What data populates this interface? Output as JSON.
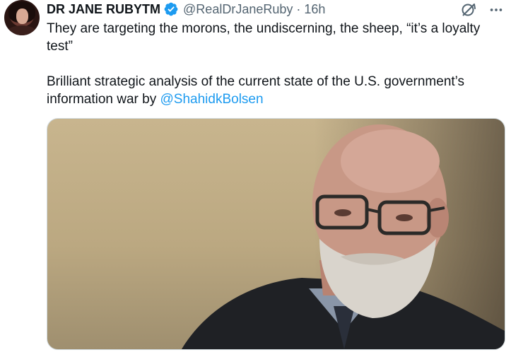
{
  "tweet": {
    "author_name": "DR JANE RUBY",
    "author_suffix": "TM",
    "handle": "@RealDrJaneRuby",
    "separator": "·",
    "timestamp": "16h",
    "text_line1": "They are targeting the morons, the undiscerning, the sheep, “it’s a loyalty test”",
    "text_line2_prefix": "Brilliant strategic analysis of the current state of the U.S. government’s information war by ",
    "mention": "@ShahidkBolsen"
  },
  "icons": {
    "verified": "verified-badge-icon",
    "grok": "grok-icon",
    "more": "more-options-icon"
  },
  "colors": {
    "accent": "#1d9bf0",
    "text": "#0f1419",
    "muted": "#536471"
  }
}
